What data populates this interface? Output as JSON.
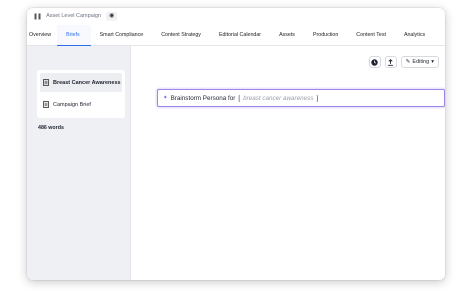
{
  "header": {
    "campaign_title": "Asset Level Campaign"
  },
  "tabs": [
    {
      "label": "Overview",
      "active": false
    },
    {
      "label": "Briefs",
      "active": true
    },
    {
      "label": "Smart Compliance",
      "active": false
    },
    {
      "label": "Content Strategy",
      "active": false
    },
    {
      "label": "Editorial Calendar",
      "active": false
    },
    {
      "label": "Assets",
      "active": false
    },
    {
      "label": "Production",
      "active": false
    },
    {
      "label": "Content Test",
      "active": false
    },
    {
      "label": "Analytics",
      "active": false
    }
  ],
  "sidebar": {
    "briefs": [
      {
        "label": "Breast Cancer Awareness",
        "selected": true,
        "icon": "document-icon"
      },
      {
        "label": "Campaign Brief",
        "selected": false,
        "icon": "document-icon"
      }
    ],
    "word_count": "486 words"
  },
  "toolbar": {
    "history_icon": "clock-icon",
    "export_icon": "upload-icon",
    "mode_label": "Editing",
    "mode_icon": "pencil-icon"
  },
  "prompt": {
    "text": "Brainstorm Persona for",
    "open_bracket": "[",
    "placeholder": "breast cancer awareness",
    "close_bracket": "]"
  },
  "colors": {
    "accent": "#2f6fed",
    "prompt_border": "#9d86e8",
    "sidebar_bg": "#eef0f3"
  }
}
